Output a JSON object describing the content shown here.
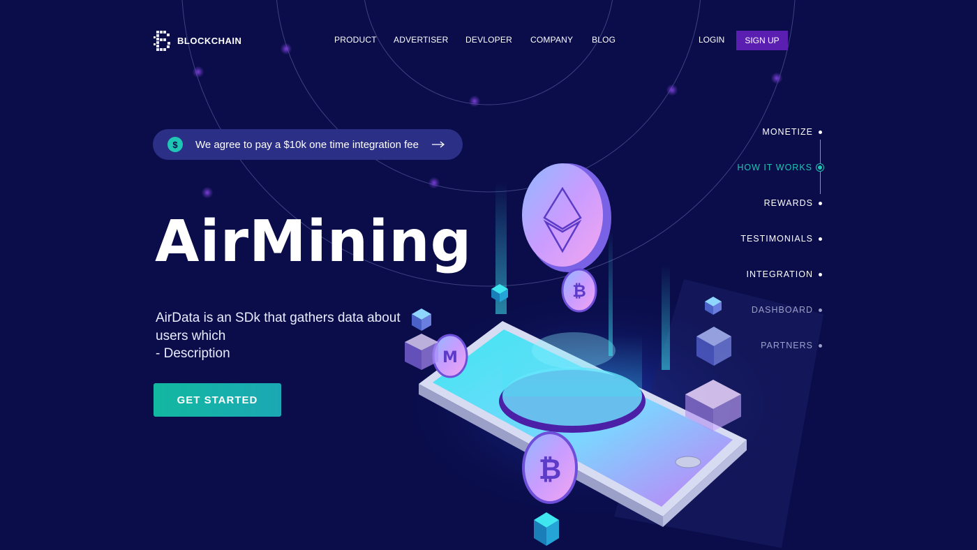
{
  "brand": {
    "name": "BLOCKCHAIN"
  },
  "nav": {
    "items": [
      "PRODUCT",
      "ADVERTISER",
      "DEVLOPER",
      "COMPANY",
      "BLOG"
    ],
    "login": "LOGIN",
    "signup": "SIGN UP"
  },
  "announcement": {
    "icon": "$",
    "text": "We agree to pay a $10k one time integration fee",
    "arrow_icon": "arrow-right-icon"
  },
  "hero": {
    "title": "AirMining",
    "description_lines": [
      "AirData is an SDk that gathers data about",
      "users which",
      "- Description"
    ],
    "cta": "GET STARTED"
  },
  "sections": {
    "items": [
      {
        "label": "MONETIZE",
        "state": "normal"
      },
      {
        "label": "HOW IT WORKS",
        "state": "active"
      },
      {
        "label": "REWARDS",
        "state": "normal"
      },
      {
        "label": "TESTIMONIALS",
        "state": "normal"
      },
      {
        "label": "INTEGRATION",
        "state": "normal"
      },
      {
        "label": "DASHBOARD",
        "state": "dim"
      },
      {
        "label": "PARTNERS",
        "state": "dim"
      }
    ]
  },
  "colors": {
    "background": "#0a0d4a",
    "accent_teal": "#1ec6b3",
    "signup_purple": "#5a1fb0",
    "pill_bg": "#2b2f85"
  }
}
